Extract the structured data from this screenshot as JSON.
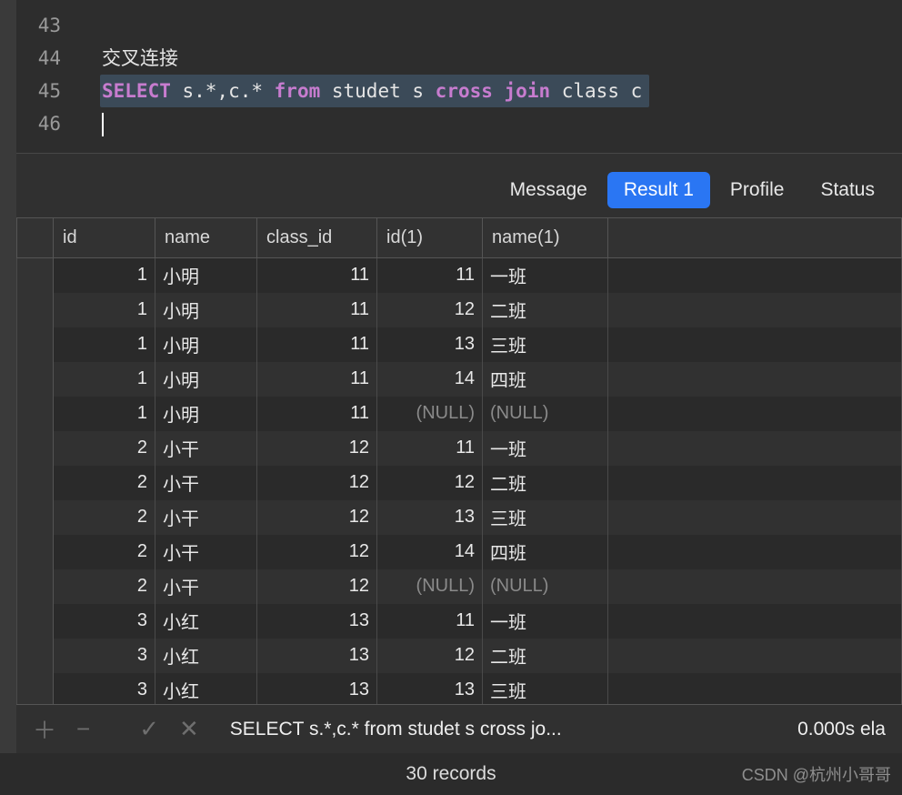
{
  "editor": {
    "lines": [
      "43",
      "44",
      "45",
      "46"
    ],
    "comment": "交叉连接",
    "sql_tokens": {
      "select": "SELECT",
      "fields": " s.*,c.* ",
      "from": "from",
      "tbl1": " studet s ",
      "cross": "cross",
      "join": " join",
      "tbl2": " class c"
    }
  },
  "tabs": {
    "message": "Message",
    "result": "Result 1",
    "profile": "Profile",
    "status": "Status"
  },
  "columns": [
    "id",
    "name",
    "class_id",
    "id(1)",
    "name(1)"
  ],
  "rows": [
    {
      "id": "1",
      "name": "小明",
      "class_id": "11",
      "id1": "11",
      "name1": "一班"
    },
    {
      "id": "1",
      "name": "小明",
      "class_id": "11",
      "id1": "12",
      "name1": "二班"
    },
    {
      "id": "1",
      "name": "小明",
      "class_id": "11",
      "id1": "13",
      "name1": "三班"
    },
    {
      "id": "1",
      "name": "小明",
      "class_id": "11",
      "id1": "14",
      "name1": "四班"
    },
    {
      "id": "1",
      "name": "小明",
      "class_id": "11",
      "id1": "(NULL)",
      "name1": "(NULL)",
      "null": true
    },
    {
      "id": "2",
      "name": "小干",
      "class_id": "12",
      "id1": "11",
      "name1": "一班"
    },
    {
      "id": "2",
      "name": "小干",
      "class_id": "12",
      "id1": "12",
      "name1": "二班"
    },
    {
      "id": "2",
      "name": "小干",
      "class_id": "12",
      "id1": "13",
      "name1": "三班"
    },
    {
      "id": "2",
      "name": "小干",
      "class_id": "12",
      "id1": "14",
      "name1": "四班"
    },
    {
      "id": "2",
      "name": "小干",
      "class_id": "12",
      "id1": "(NULL)",
      "name1": "(NULL)",
      "null": true
    },
    {
      "id": "3",
      "name": "小红",
      "class_id": "13",
      "id1": "11",
      "name1": "一班"
    },
    {
      "id": "3",
      "name": "小红",
      "class_id": "13",
      "id1": "12",
      "name1": "二班"
    },
    {
      "id": "3",
      "name": "小红",
      "class_id": "13",
      "id1": "13",
      "name1": "三班"
    }
  ],
  "toolbar": {
    "add": "＋",
    "remove": "−",
    "apply": "✓",
    "cancel": "✕",
    "sql": "SELECT s.*,c.* from studet s cross jo...",
    "timing": "0.000s ela"
  },
  "status": {
    "records": "30 records"
  },
  "watermark": "CSDN @杭州小哥哥"
}
